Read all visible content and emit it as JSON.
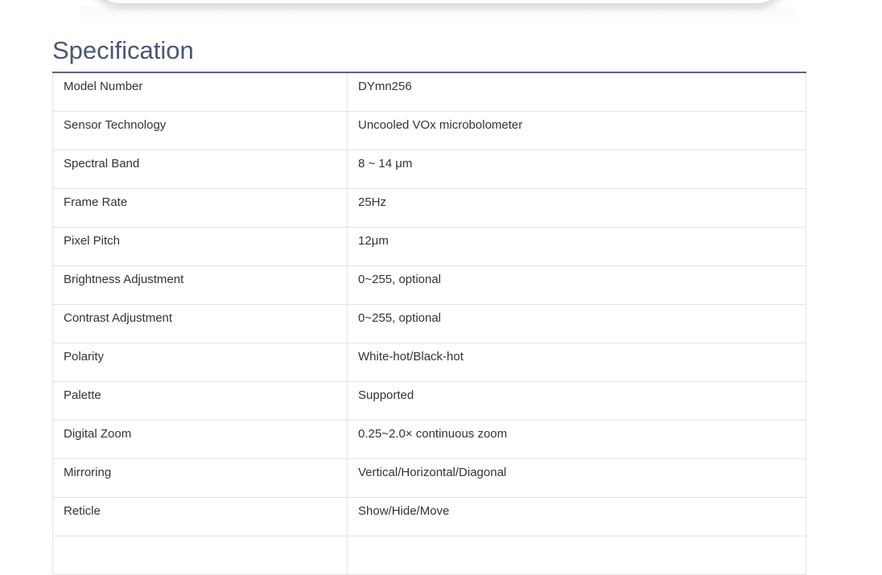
{
  "section": {
    "title": "Specification"
  },
  "spec_rows": [
    {
      "label": "Model Number",
      "value": "DYmn256"
    },
    {
      "label": "Sensor Technology",
      "value": "Uncooled VOx microbolometer"
    },
    {
      "label": "Spectral Band",
      "value": "8 ~ 14 μm"
    },
    {
      "label": "Frame Rate",
      "value": "25Hz"
    },
    {
      "label": "Pixel Pitch",
      "value": "12μm"
    },
    {
      "label": "Brightness Adjustment",
      "value": "0~255, optional"
    },
    {
      "label": "Contrast Adjustment",
      "value": "0~255, optional"
    },
    {
      "label": "Polarity",
      "value": "White-hot/Black-hot"
    },
    {
      "label": "Palette",
      "value": "Supported"
    },
    {
      "label": "Digital Zoom",
      "value": "0.25~2.0× continuous zoom"
    },
    {
      "label": "Mirroring",
      "value": "Vertical/Horizontal/Diagonal"
    },
    {
      "label": "Reticle",
      "value": "Show/Hide/Move"
    },
    {
      "label": "",
      "value": ""
    }
  ],
  "colors": {
    "title": "#4a5775",
    "rule": "#5b6580",
    "border": "#e3e3e3",
    "text": "#333333"
  }
}
